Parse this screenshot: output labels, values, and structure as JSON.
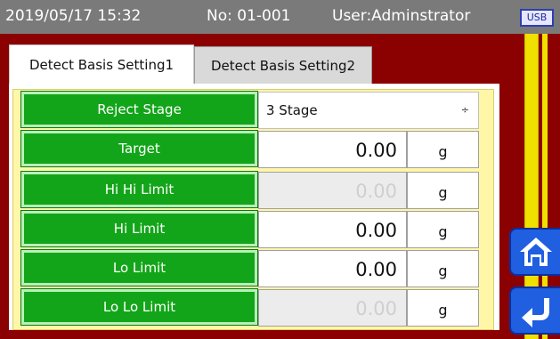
{
  "header": {
    "datetime": "2019/05/17 15:32",
    "number": "No: 01-001",
    "user": "User:Adminstrator",
    "usb_label": "USB"
  },
  "tabs": [
    {
      "label": "Detect Basis Setting1",
      "active": true
    },
    {
      "label": "Detect Basis Setting2",
      "active": false
    }
  ],
  "reject_stage": {
    "label": "Reject Stage",
    "value": "3 Stage",
    "arrows": "÷"
  },
  "rows": [
    {
      "label": "Target",
      "value": "0.00",
      "unit": "g",
      "enabled": true
    },
    {
      "label": "Hi Hi Limit",
      "value": "0.00",
      "unit": "g",
      "enabled": false
    },
    {
      "label": "Hi Limit",
      "value": "0.00",
      "unit": "g",
      "enabled": true
    },
    {
      "label": "Lo Limit",
      "value": "0.00",
      "unit": "g",
      "enabled": true
    },
    {
      "label": "Lo Lo Limit",
      "value": "0.00",
      "unit": "g",
      "enabled": false
    }
  ],
  "side_buttons": [
    {
      "icon": "home-icon"
    },
    {
      "icon": "return-icon"
    }
  ],
  "colors": {
    "background": "#8b0000",
    "label_green": "#13a519",
    "side_blue": "#1f5fe0",
    "side_rail": "#f0e000",
    "panel_yellow": "#fff6a8"
  }
}
